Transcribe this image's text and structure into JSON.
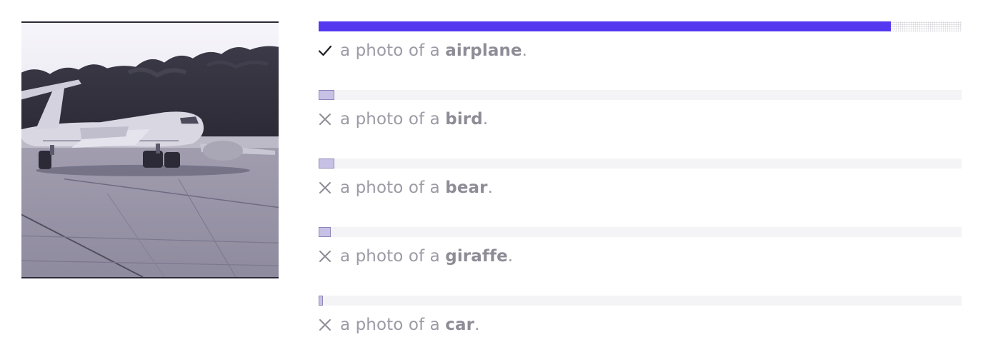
{
  "image": {
    "alt": "airplane on tarmac",
    "icon": "airplane-photo"
  },
  "predictions": [
    {
      "prefix": "a photo of a ",
      "label": "airplane",
      "suffix": ".",
      "probability": 0.89,
      "correct": true,
      "icon": "checkmark-icon"
    },
    {
      "prefix": "a photo of a ",
      "label": "bird",
      "suffix": ".",
      "probability": 0.024,
      "correct": false,
      "icon": "cross-icon"
    },
    {
      "prefix": "a photo of a ",
      "label": "bear",
      "suffix": ".",
      "probability": 0.024,
      "correct": false,
      "icon": "cross-icon"
    },
    {
      "prefix": "a photo of a ",
      "label": "giraffe",
      "suffix": ".",
      "probability": 0.019,
      "correct": false,
      "icon": "cross-icon"
    },
    {
      "prefix": "a photo of a ",
      "label": "car",
      "suffix": ".",
      "probability": 0.007,
      "correct": false,
      "icon": "cross-icon"
    }
  ],
  "colors": {
    "top_bar": "#5438f0",
    "other_bar": "#c7c1e6",
    "track": "#f4f4f6"
  }
}
